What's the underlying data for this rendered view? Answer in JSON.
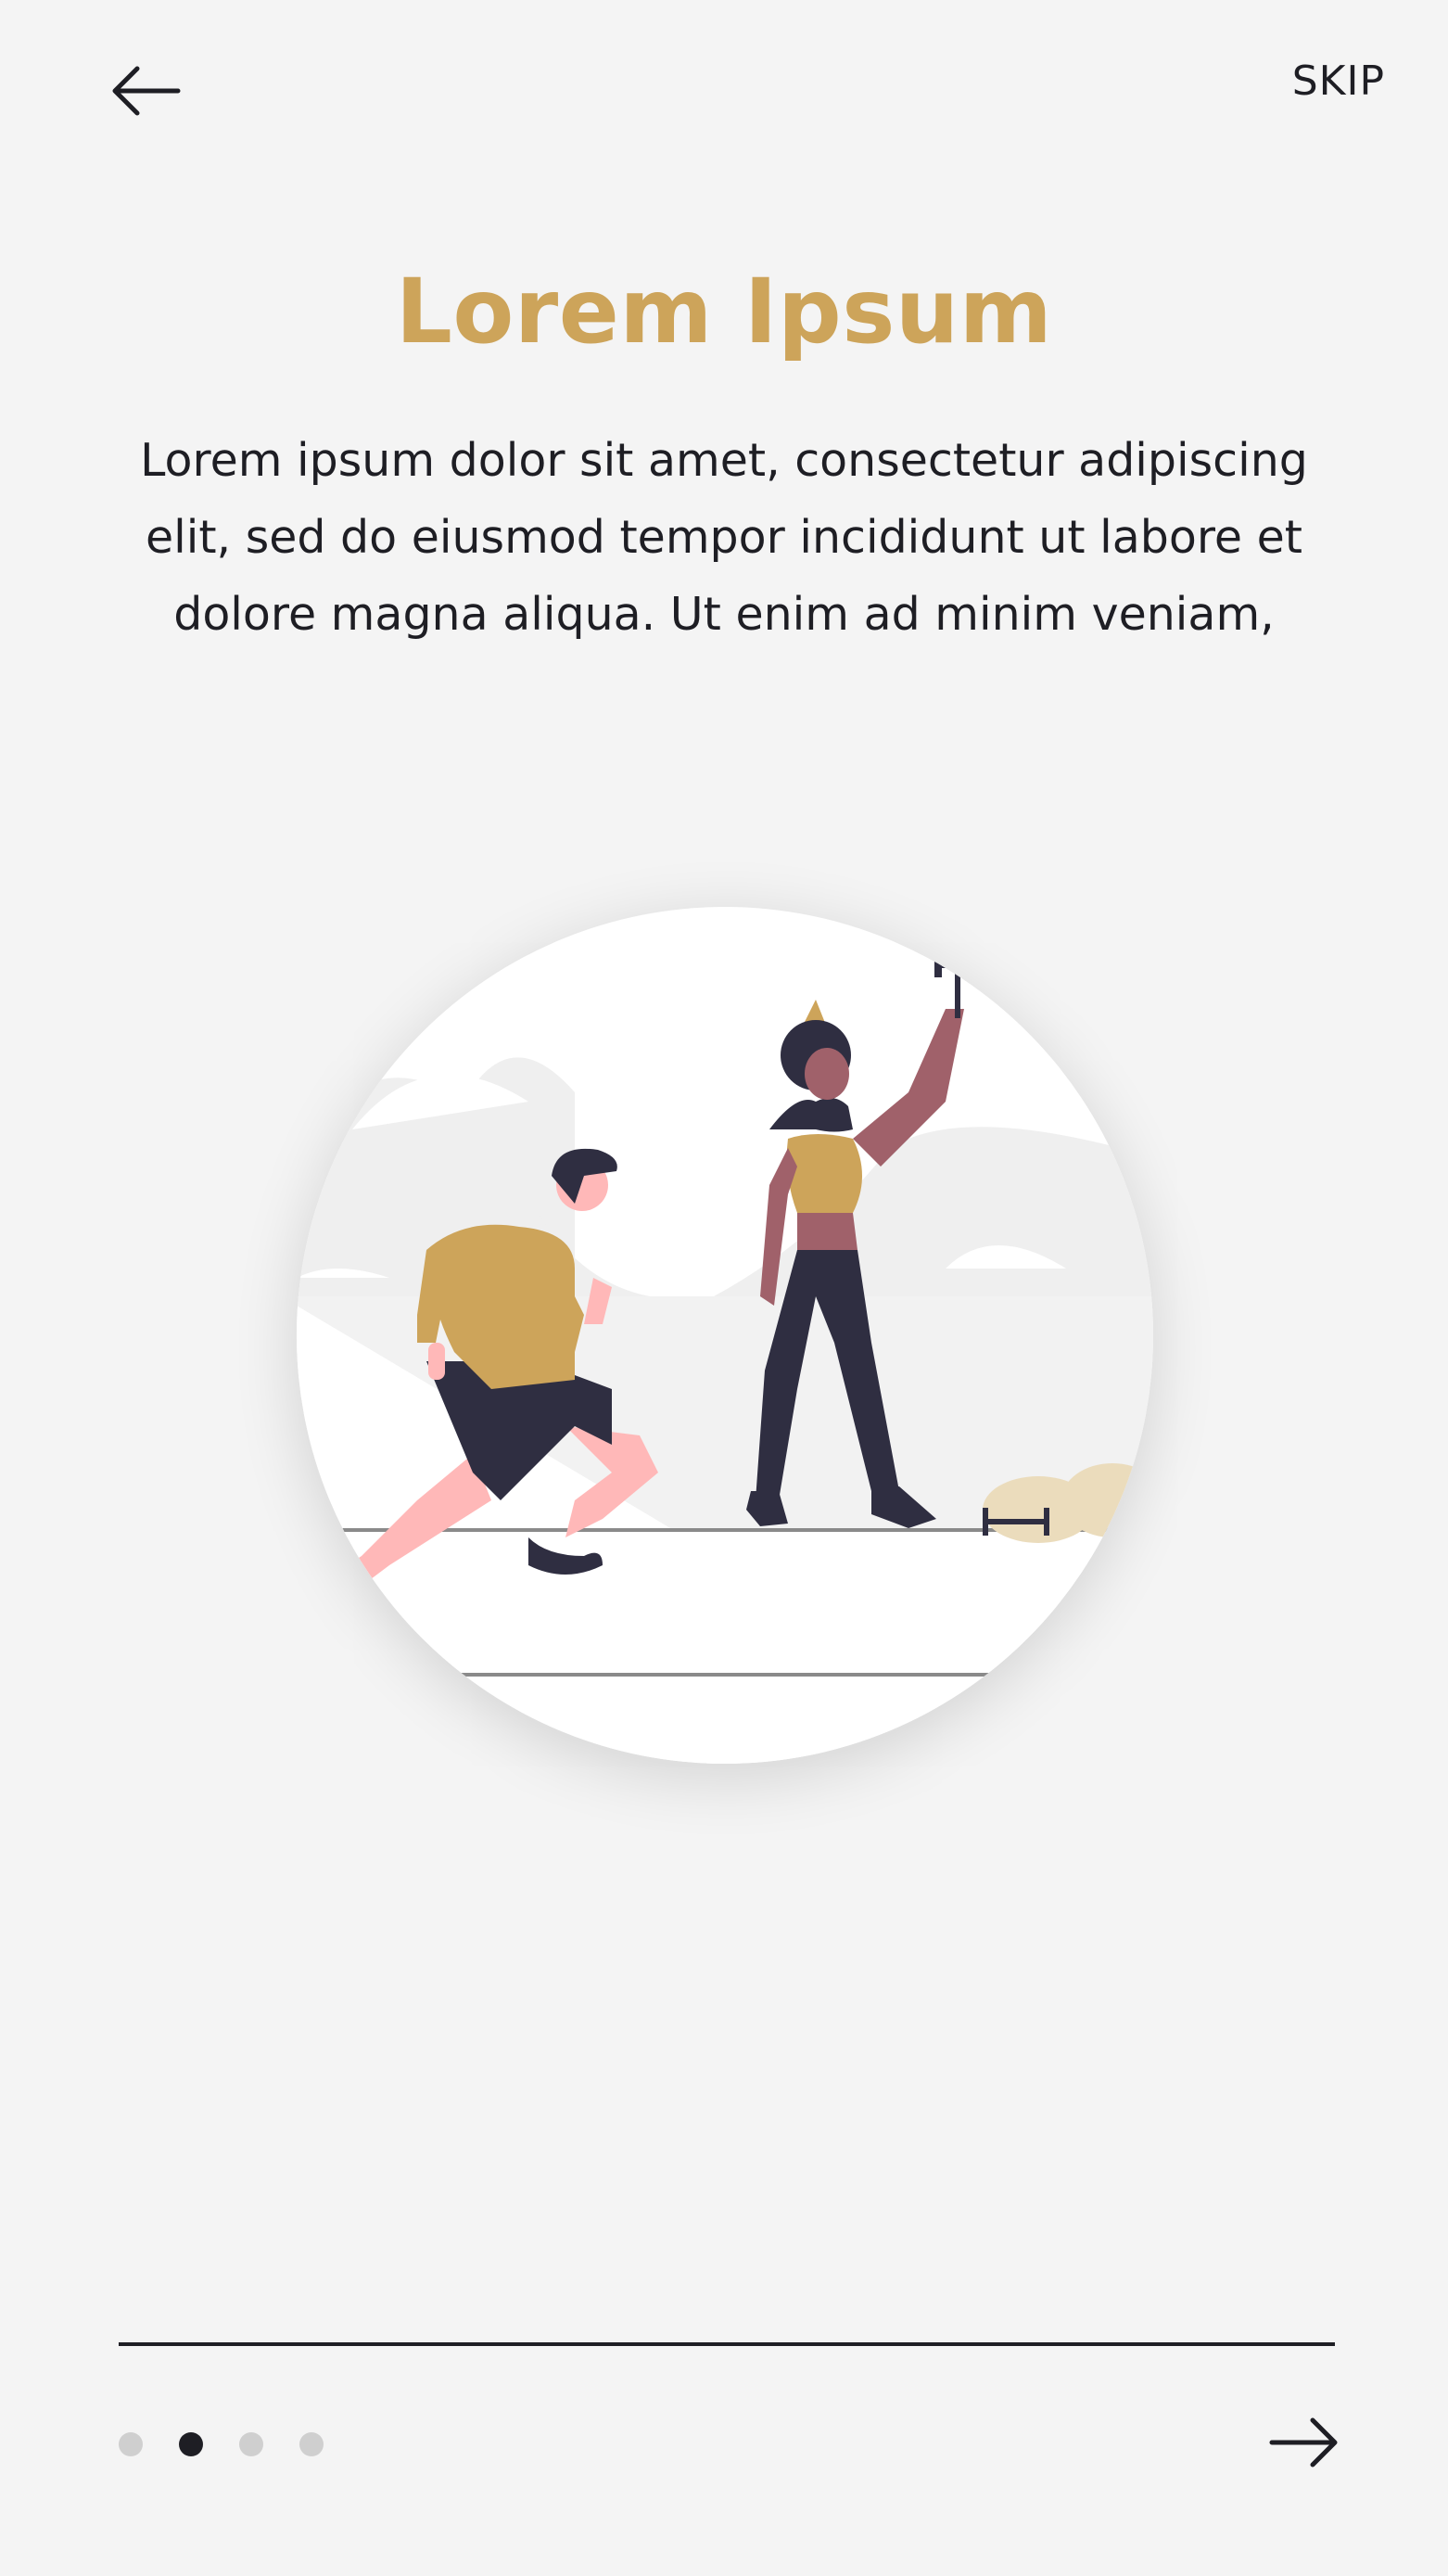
{
  "header": {
    "back_icon": "arrow-left-icon",
    "skip_label": "SKIP"
  },
  "content": {
    "title": "Lorem Ipsum",
    "description": "Lorem ipsum dolor sit amet, consectetur adipiscing elit, sed do eiusmod tempor incididunt ut labore et dolore magna aliqua. Ut enim ad minim veniam,"
  },
  "illustration": {
    "icon": "fitness-illustration"
  },
  "footer": {
    "page_indicator": {
      "total": 4,
      "active_index": 1
    },
    "next_icon": "arrow-right-icon"
  },
  "colors": {
    "accent": "#cda45a",
    "text": "#1e1e24",
    "background": "#f4f4f4",
    "dot_inactive": "#cfcfcf"
  }
}
